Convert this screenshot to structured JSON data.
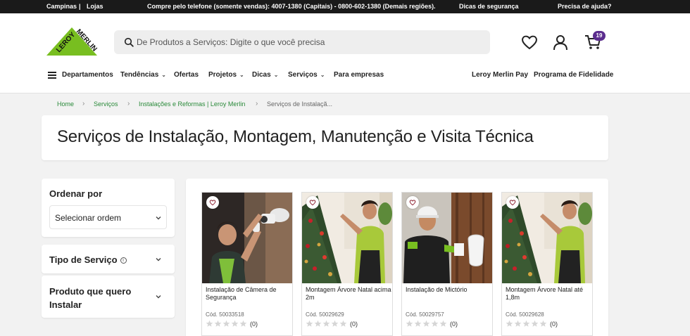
{
  "topbar": {
    "location": "Campinas",
    "separator": "|",
    "stores": "Lojas",
    "phone": "Compre pelo telefone (somente vendas): 4007-1380 (Capitais) - 0800-602-1380 (Demais regiões).",
    "safety": "Dicas de segurança",
    "help": "Precisa de ajuda?"
  },
  "header": {
    "logo_text": "LEROY MERLIN",
    "search_placeholder": "De Produtos a Serviços: Digite o que você precisa",
    "cart_count": "19"
  },
  "nav": {
    "items": [
      {
        "label": "Departamentos"
      },
      {
        "label": "Tendências"
      },
      {
        "label": "Ofertas"
      },
      {
        "label": "Projetos"
      },
      {
        "label": "Dicas"
      },
      {
        "label": "Serviços"
      },
      {
        "label": "Para empresas"
      },
      {
        "label": "Leroy Merlin Pay"
      },
      {
        "label": "Programa de Fidelidade"
      }
    ]
  },
  "breadcrumb": {
    "items": [
      {
        "label": "Home"
      },
      {
        "label": "Serviços"
      },
      {
        "label": "Instalações e Reformas | Leroy Merlin"
      },
      {
        "label": "Serviços de Instalaçã..."
      }
    ]
  },
  "page": {
    "title": "Serviços de Instalação, Montagem, Manutenção e Visita Técnica"
  },
  "filters": {
    "sort_title": "Ordenar por",
    "sort_value": "Selecionar ordem",
    "service_type": "Tipo de Serviço",
    "info_glyph": "i",
    "product_title": "Produto que quero Instalar"
  },
  "products": [
    {
      "name": "Instalação de Câmera de Segurança",
      "code": "Cód. 50033518",
      "reviews": "(0)",
      "rating": 0
    },
    {
      "name": "Montagem Árvore Natal acima 2m",
      "code": "Cód. 50029629",
      "reviews": "(0)",
      "rating": 0
    },
    {
      "name": "Instalação de Mictório",
      "code": "Cód. 50029757",
      "reviews": "(0)",
      "rating": 0
    },
    {
      "name": "Montagem Árvore Natal até 1,8m",
      "code": "Cód. 50029628",
      "reviews": "(0)",
      "rating": 0
    }
  ],
  "colors": {
    "brand_green": "#78be20",
    "link_green": "#2a8a3a",
    "cart_badge": "#5b2d8e",
    "topbar_bg": "#1a1a1a"
  },
  "icons": {
    "search": "search-icon",
    "wishlist": "heart-icon",
    "account": "user-icon",
    "cart": "cart-icon",
    "menu": "hamburger-icon"
  }
}
